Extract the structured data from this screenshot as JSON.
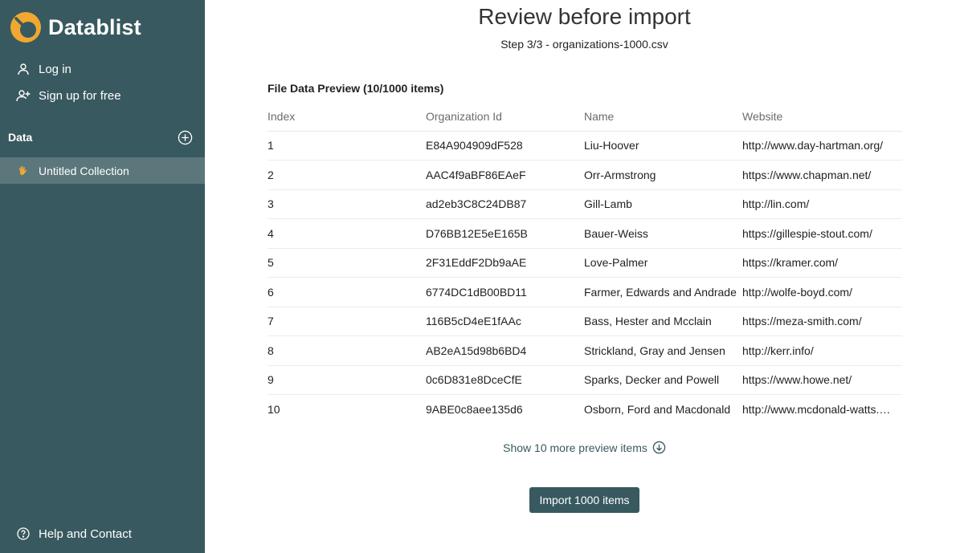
{
  "app": {
    "name": "Datablist",
    "logo_icon": "datablist-logo-icon",
    "brand_color": "#38595f",
    "logo_color": "#f0a830"
  },
  "sidebar": {
    "login_label": "Log in",
    "signup_label": "Sign up for free",
    "section_title": "Data",
    "collections": [
      {
        "label": "Untitled Collection",
        "icon": "hand-wave-icon"
      }
    ],
    "help_label": "Help and Contact"
  },
  "main": {
    "title": "Review before import",
    "subtitle": "Step 3/3 - organizations-1000.csv",
    "preview_title": "File Data Preview (10/1000 items)",
    "columns": [
      "Index",
      "Organization Id",
      "Name",
      "Website"
    ],
    "rows": [
      [
        "1",
        "E84A904909dF528",
        "Liu-Hoover",
        "http://www.day-hartman.org/"
      ],
      [
        "2",
        "AAC4f9aBF86EAeF",
        "Orr-Armstrong",
        "https://www.chapman.net/"
      ],
      [
        "3",
        "ad2eb3C8C24DB87",
        "Gill-Lamb",
        "http://lin.com/"
      ],
      [
        "4",
        "D76BB12E5eE165B",
        "Bauer-Weiss",
        "https://gillespie-stout.com/"
      ],
      [
        "5",
        "2F31EddF2Db9aAE",
        "Love-Palmer",
        "https://kramer.com/"
      ],
      [
        "6",
        "6774DC1dB00BD11",
        "Farmer, Edwards and Andrade",
        "http://wolfe-boyd.com/"
      ],
      [
        "7",
        "116B5cD4eE1fAAc",
        "Bass, Hester and Mcclain",
        "https://meza-smith.com/"
      ],
      [
        "8",
        "AB2eA15d98b6BD4",
        "Strickland, Gray and Jensen",
        "http://kerr.info/"
      ],
      [
        "9",
        "0c6D831e8DceCfE",
        "Sparks, Decker and Powell",
        "https://www.howe.net/"
      ],
      [
        "10",
        "9ABE0c8aee135d6",
        "Osborn, Ford and Macdonald",
        "http://www.mcdonald-watts.…"
      ]
    ],
    "more_label": "Show 10 more preview items",
    "import_label": "Import 1000 items"
  }
}
